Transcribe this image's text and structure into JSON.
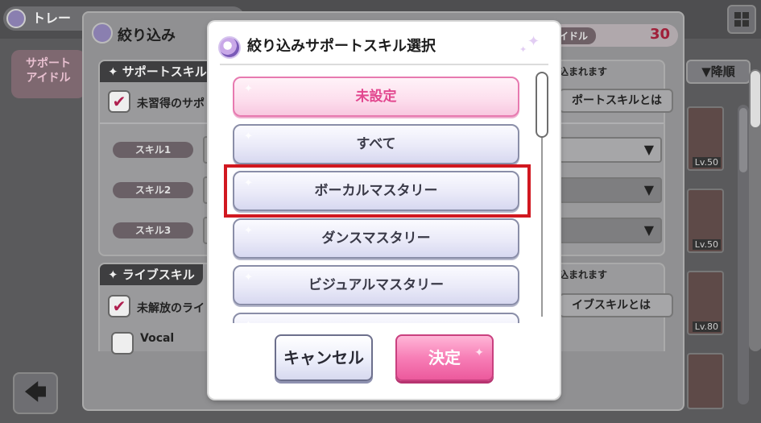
{
  "background": {
    "title": "トレー",
    "left_panel_label": "サポート\nアイドル",
    "sort_label": "▼降順",
    "back_icon": "arrow-left-icon",
    "cards": [
      {
        "level": "Lv.50"
      },
      {
        "level": "Lv.50"
      },
      {
        "level": "Lv.80"
      }
    ]
  },
  "filter_dialog": {
    "title": "絞り込み",
    "idol_tag": "イドル",
    "idol_count": "30",
    "support_section": {
      "header": "✦ サポートスキル",
      "note": "込まれます",
      "info_button": "ポートスキルとは",
      "unacquired_label": "未習得のサポ",
      "skills": [
        {
          "label": "スキル1"
        },
        {
          "label": "スキル2"
        },
        {
          "label": "スキル3"
        }
      ]
    },
    "live_section": {
      "header": "✦ ライブスキル",
      "note": "込まれます",
      "info_button": "イブスキルとは",
      "unreleased_label": "未解放のライ",
      "vocal_label": "Vocal"
    }
  },
  "select_dialog": {
    "title": "絞り込みサポートスキル選択",
    "options": [
      {
        "label": "未設定",
        "selected": true
      },
      {
        "label": "すべて",
        "selected": false
      },
      {
        "label": "ボーカルマスタリー",
        "selected": false
      },
      {
        "label": "ダンスマスタリー",
        "selected": false
      },
      {
        "label": "ビジュアルマスタリー",
        "selected": false
      }
    ],
    "cancel_label": "キャンセル",
    "ok_label": "決定"
  },
  "colors": {
    "selected_pink": "#e2478f",
    "highlight_red": "#d11820",
    "ok_pink": "#f77eb6"
  }
}
